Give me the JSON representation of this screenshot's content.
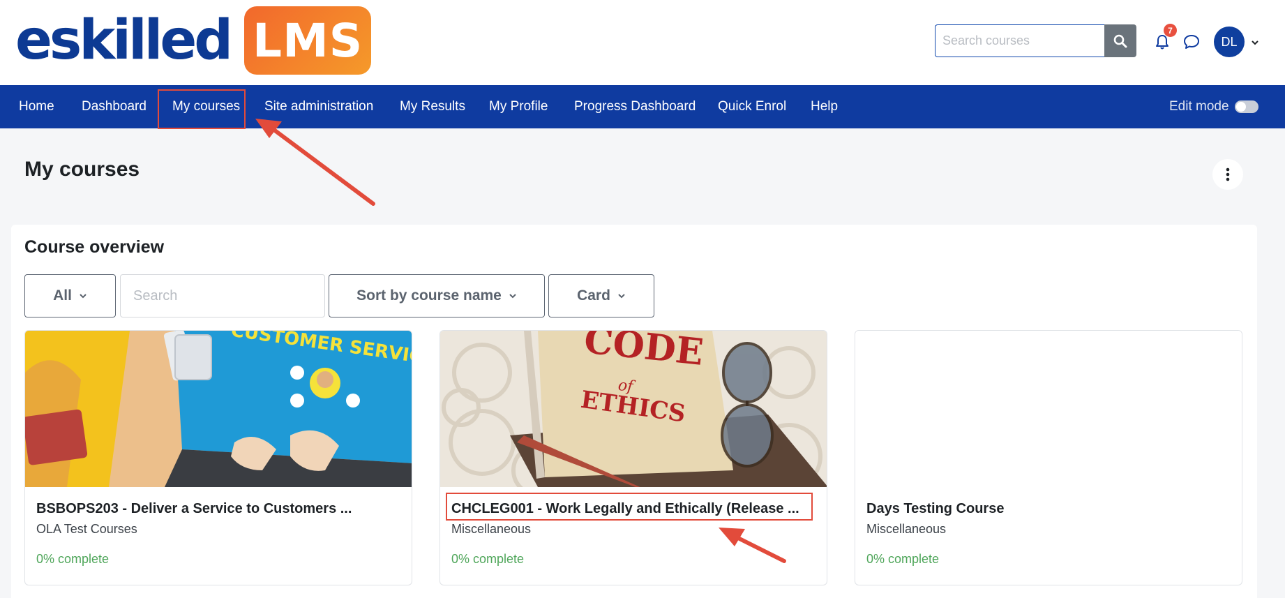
{
  "header": {
    "logo_text": "eskilled",
    "logo_badge": "LMS",
    "search_placeholder": "Search courses",
    "notification_count": "7",
    "avatar_initials": "DL"
  },
  "nav": {
    "items": [
      "Home",
      "Dashboard",
      "My courses",
      "Site administration",
      "My Results",
      "My Profile",
      "Progress Dashboard",
      "Quick Enrol",
      "Help"
    ],
    "active": "My courses",
    "edit_mode_label": "Edit mode"
  },
  "page": {
    "title": "My courses"
  },
  "overview": {
    "title": "Course overview",
    "filter_label": "All",
    "search_placeholder": "Search",
    "sort_label": "Sort by course name",
    "view_label": "Card"
  },
  "courses": [
    {
      "title": "BSBOPS203 - Deliver a Service to Customers ...",
      "category": "OLA Test Courses",
      "progress": "0% complete",
      "image_text": "CUSTOMER SERVICE"
    },
    {
      "title": "CHCLEG001 - Work Legally and Ethically (Release ...",
      "category": "Miscellaneous",
      "progress": "0% complete",
      "image_text_1": "CODE",
      "image_text_2": "of",
      "image_text_3": "ETHICS"
    },
    {
      "title": "Days Testing Course",
      "category": "Miscellaneous",
      "progress": "0% complete"
    }
  ],
  "colors": {
    "brand_blue": "#0f3ba0",
    "brand_orange": "#f2682c",
    "highlight_red": "#e24b3b",
    "progress_green": "#4fa65a"
  }
}
